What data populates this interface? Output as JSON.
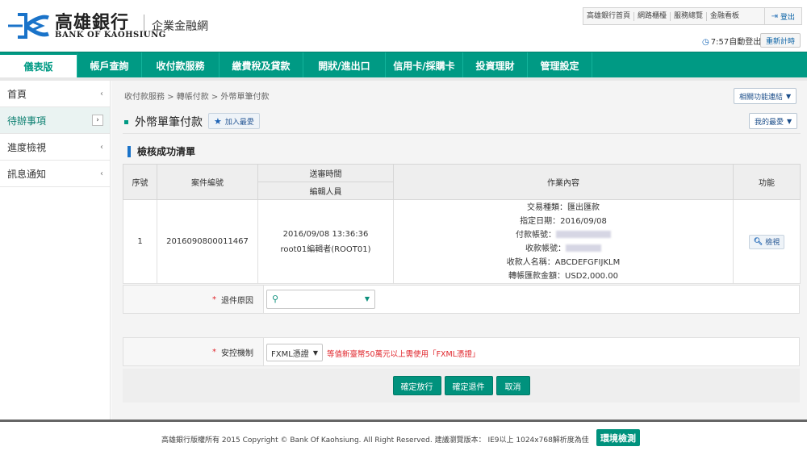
{
  "brand": {
    "name_zh": "高雄銀行",
    "name_en": "BANK OF KAOHSIUNG",
    "system_name": "企業金融網",
    "logo_color": "#1a73c9",
    "accent_color": "#009a84"
  },
  "top_links": {
    "items": [
      "高雄銀行首頁",
      "網路櫃檯",
      "服務總覽",
      "金融看板"
    ],
    "logout_label": "登出",
    "logout_icon": "logout-icon"
  },
  "session": {
    "countdown": "7:57自動登出",
    "clock_icon": "clock-icon",
    "reset_label": "重新計時"
  },
  "nav": {
    "items": [
      "儀表版",
      "帳戶查詢",
      "收付款服務",
      "繳費稅及貸款",
      "開狀/進出口",
      "信用卡/採購卡",
      "投資理財",
      "管理設定"
    ],
    "active_index": 0
  },
  "sidebar": {
    "items": [
      {
        "label": "首頁",
        "chevron": "‹"
      },
      {
        "label": "待辦事項",
        "chevron": "›"
      },
      {
        "label": "進度檢視",
        "chevron": "‹"
      },
      {
        "label": "訊息通知",
        "chevron": "‹"
      }
    ],
    "active_index": 1
  },
  "breadcrumb": "收付款服務 > 轉帳付款 > 外幣單筆付款",
  "related_links_label": "相關功能連結",
  "my_fav_label": "我的最愛",
  "page_title": "外幣單筆付款",
  "add_fav_label": "加入最愛",
  "section_title": "檢核成功清單",
  "table": {
    "headers": {
      "seq": "序號",
      "case_no": "案件編號",
      "send_time": "送審時間",
      "editor": "編輯人員",
      "content": "作業內容",
      "action": "功能"
    },
    "rows": [
      {
        "seq": "1",
        "case_no": "2016090800011467",
        "send_time": "2016/09/08 13:36:36",
        "editor": "root01編輯者(ROOT01)",
        "details": {
          "tx_type": "交易種類：匯出匯款",
          "date": "指定日期：2016/09/08",
          "pay_acct_label": "付款帳號：",
          "recv_acct_label": "收款帳號：",
          "payee": "收款人名稱：ABCDEFGFIJKLM",
          "amount": "轉帳匯款金額：USD2,000.00"
        },
        "view_label": "檢視"
      }
    ]
  },
  "return_reason": {
    "label": "退件原因",
    "required_mark": "*"
  },
  "security": {
    "label": "安控機制",
    "required_mark": "*",
    "selected": "FXML憑證",
    "warning": "等值新臺幣50萬元以上需使用「FXML憑證」"
  },
  "buttons": {
    "release": "確定放行",
    "return": "確定退件",
    "cancel": "取消"
  },
  "footer": {
    "text": "高雄銀行版權所有 2015 Copyright © Bank Of Kaohsiung. All Right Reserved. 建議瀏覽版本： IE9以上 1024x768解析度為佳",
    "env_label": "環境檢測"
  }
}
